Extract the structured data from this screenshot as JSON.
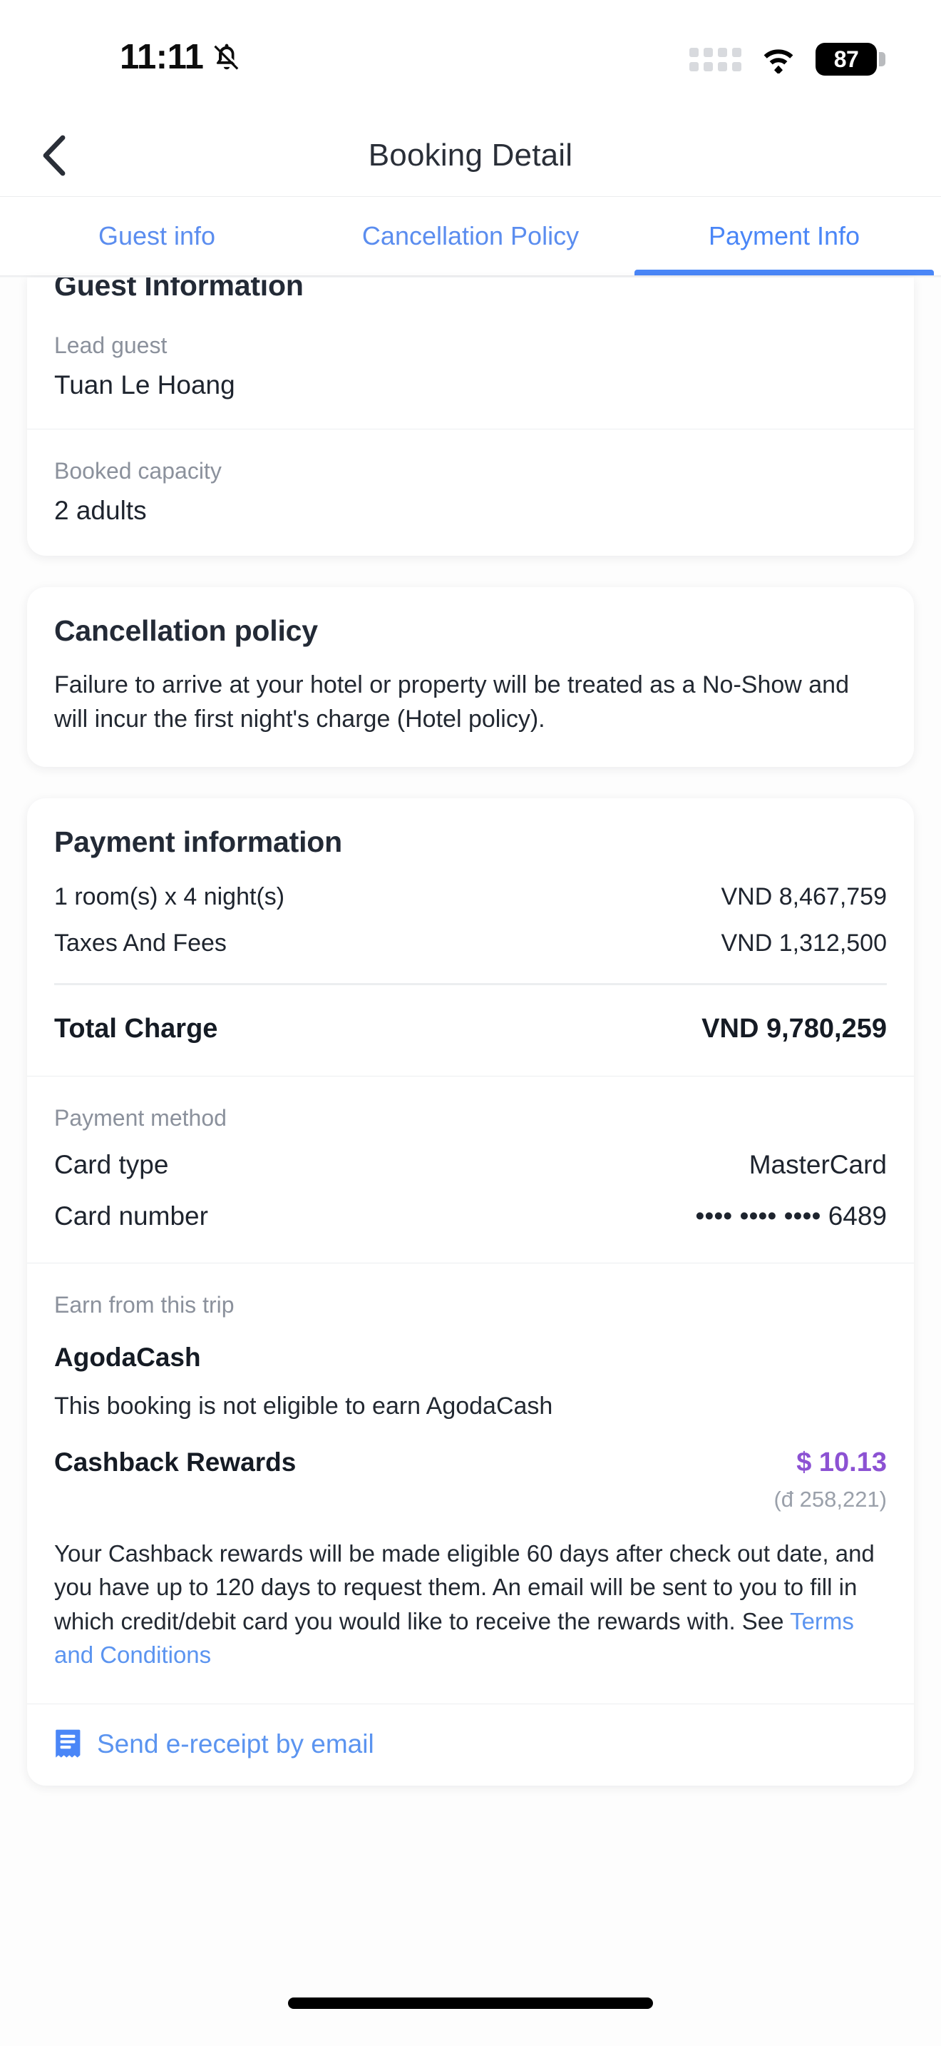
{
  "status_bar": {
    "time": "11:11",
    "bell_icon": "bell-muted-icon",
    "signal_icon": "signal-dots-icon",
    "wifi_icon": "wifi-icon",
    "battery_level": "87"
  },
  "header": {
    "back_icon": "back-chevron-icon",
    "title": "Booking Detail"
  },
  "tabs": [
    {
      "label": "Guest info",
      "active": false
    },
    {
      "label": "Cancellation Policy",
      "active": false
    },
    {
      "label": "Payment Info",
      "active": true
    }
  ],
  "guest_card": {
    "title": "Guest Information",
    "fields": [
      {
        "label": "Lead guest",
        "value": "Tuan Le Hoang"
      },
      {
        "label": "Booked capacity",
        "value": "2 adults"
      }
    ]
  },
  "cancellation_card": {
    "title": "Cancellation policy",
    "text": "Failure to arrive at your hotel or property will be treated as a No-Show and will incur the first night's charge (Hotel policy)."
  },
  "payment_card": {
    "title": "Payment information",
    "line_items": [
      {
        "label": "1 room(s) x 4 night(s)",
        "value": "VND 8,467,759"
      },
      {
        "label": "Taxes And Fees",
        "value": "VND 1,312,500"
      }
    ],
    "total_label": "Total Charge",
    "total_value": "VND 9,780,259",
    "payment_method_label": "Payment method",
    "method_rows": [
      {
        "label": "Card type",
        "value": "MasterCard"
      },
      {
        "label": "Card number",
        "value": "•••• •••• •••• 6489"
      }
    ],
    "earn_label": "Earn from this trip",
    "agodacash_title": "AgodaCash",
    "agodacash_note": "This booking is not eligible to earn AgodaCash",
    "cashback_label": "Cashback Rewards",
    "cashback_amount": "$ 10.13",
    "cashback_local": "(đ 258,221)",
    "fineprint_before": "Your Cashback rewards will be made eligible 60 days after check out date, and you have up to 120 days to request them. An email will be sent to you to fill in which credit/debit card you would like to receive the rewards with. See ",
    "fineprint_link": "Terms and Conditions",
    "receipt_icon": "receipt-icon",
    "receipt_label": "Send e-receipt by email"
  },
  "colors": {
    "accent_blue": "#4a86f7",
    "link_blue": "#5b94f0",
    "cashback_purple": "#8c52d3",
    "text_dark": "#1e242e",
    "text_muted": "#8b919c"
  }
}
